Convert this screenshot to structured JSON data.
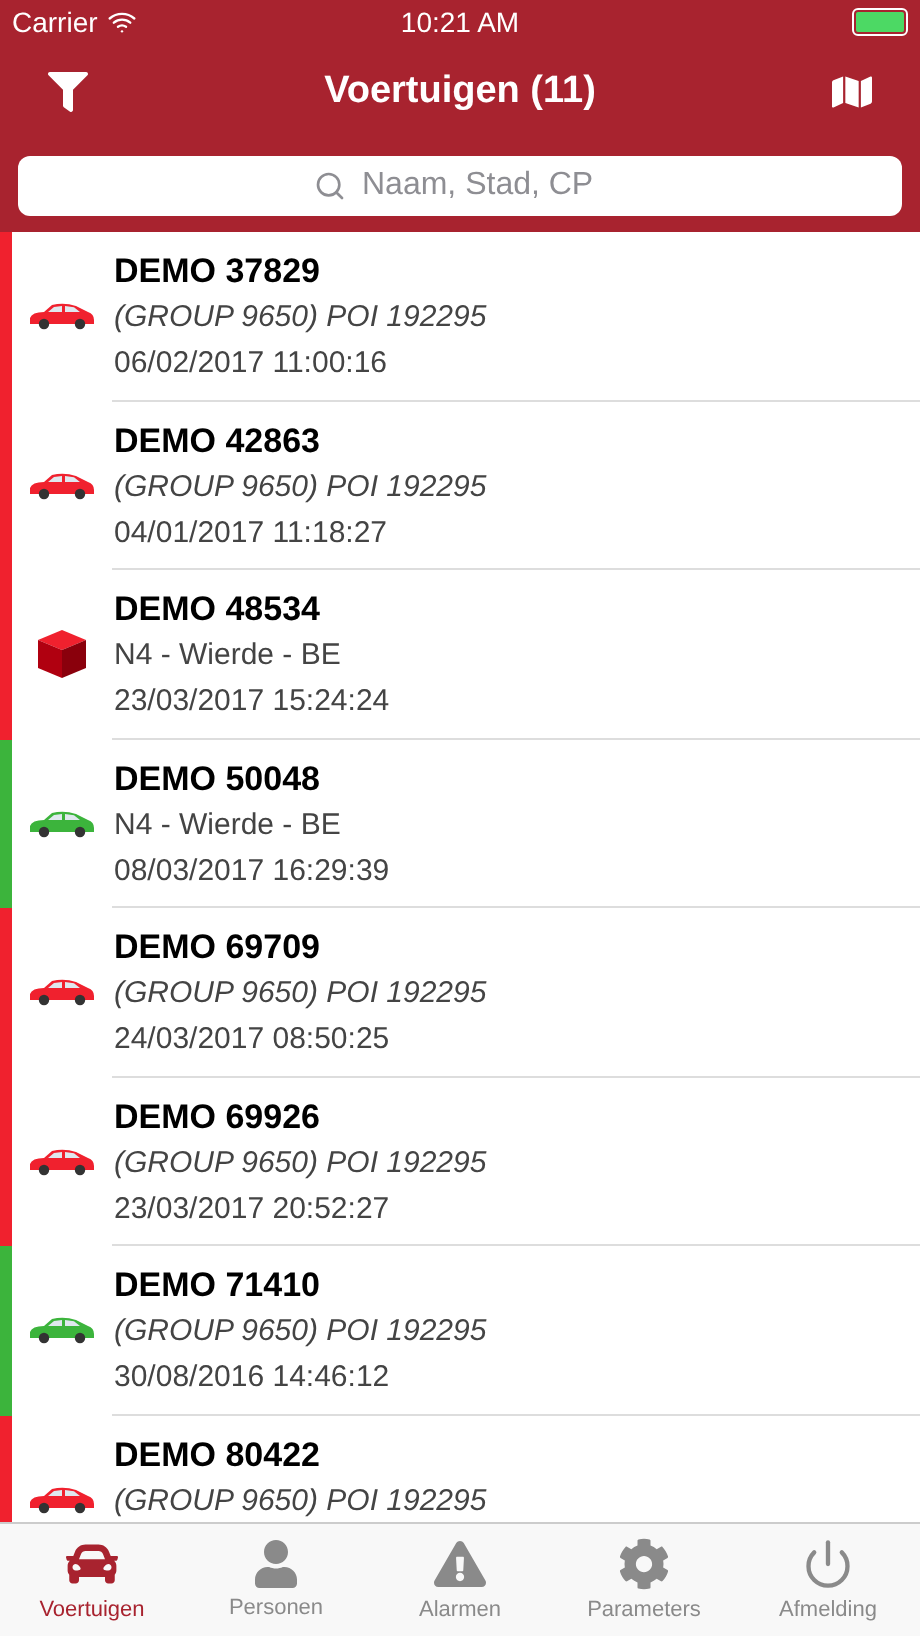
{
  "status_bar": {
    "carrier": "Carrier",
    "time": "10:21 AM"
  },
  "nav": {
    "title": "Voertuigen (11)"
  },
  "search": {
    "placeholder": "Naam, Stad, CP"
  },
  "vehicles": [
    {
      "name": "DEMO 37829",
      "location": "(GROUP 9650) POI 192295",
      "location_italic": true,
      "time": "06/02/2017 11:00:16",
      "kind": "car",
      "color": "#f0212e"
    },
    {
      "name": "DEMO 42863",
      "location": "(GROUP 9650) POI 192295",
      "location_italic": true,
      "time": "04/01/2017 11:18:27",
      "kind": "car",
      "color": "#f0212e"
    },
    {
      "name": "DEMO 48534",
      "location": "N4 - Wierde - BE",
      "location_italic": false,
      "time": "23/03/2017 15:24:24",
      "kind": "package",
      "color": "#f0212e"
    },
    {
      "name": "DEMO 50048",
      "location": "N4 - Wierde - BE",
      "location_italic": false,
      "time": "08/03/2017 16:29:39",
      "kind": "car",
      "color": "#3cb43c"
    },
    {
      "name": "DEMO 69709",
      "location": "(GROUP 9650) POI 192295",
      "location_italic": true,
      "time": "24/03/2017 08:50:25",
      "kind": "car",
      "color": "#f0212e"
    },
    {
      "name": "DEMO 69926",
      "location": "(GROUP 9650) POI 192295",
      "location_italic": true,
      "time": "23/03/2017 20:52:27",
      "kind": "car",
      "color": "#f0212e"
    },
    {
      "name": "DEMO 71410",
      "location": "(GROUP 9650) POI 192295",
      "location_italic": true,
      "time": "30/08/2016 14:46:12",
      "kind": "car",
      "color": "#3cb43c"
    },
    {
      "name": "DEMO 80422",
      "location": "(GROUP 9650) POI 192295",
      "location_italic": true,
      "kind": "car",
      "color": "#f0212e"
    }
  ],
  "tabs": [
    {
      "label": "Voertuigen",
      "kind": "car",
      "selected": true
    },
    {
      "label": "Personen",
      "kind": "person",
      "selected": false
    },
    {
      "label": "Alarmen",
      "kind": "alert",
      "selected": false
    },
    {
      "label": "Parameters",
      "kind": "gear",
      "selected": false
    },
    {
      "label": "Afmelding",
      "kind": "power",
      "selected": false
    }
  ]
}
